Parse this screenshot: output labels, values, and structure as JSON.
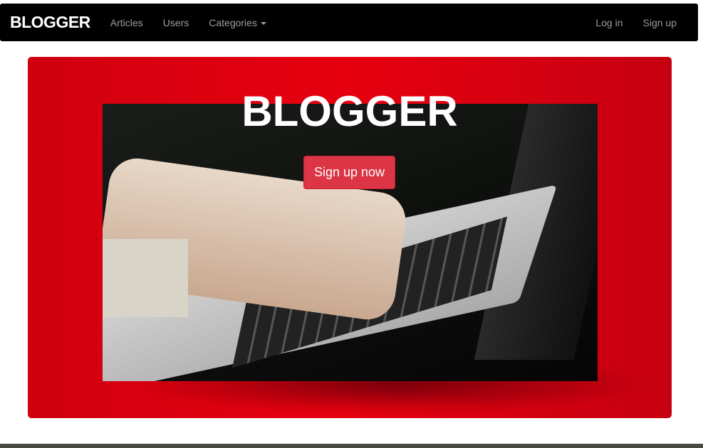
{
  "navbar": {
    "brand": "BLOGGER",
    "links": [
      "Articles",
      "Users",
      "Categories"
    ],
    "right_links": [
      "Log in",
      "Sign up"
    ]
  },
  "hero": {
    "title": "BLOGGER",
    "cta_label": "Sign up now",
    "bg_color": "#e6000f"
  }
}
